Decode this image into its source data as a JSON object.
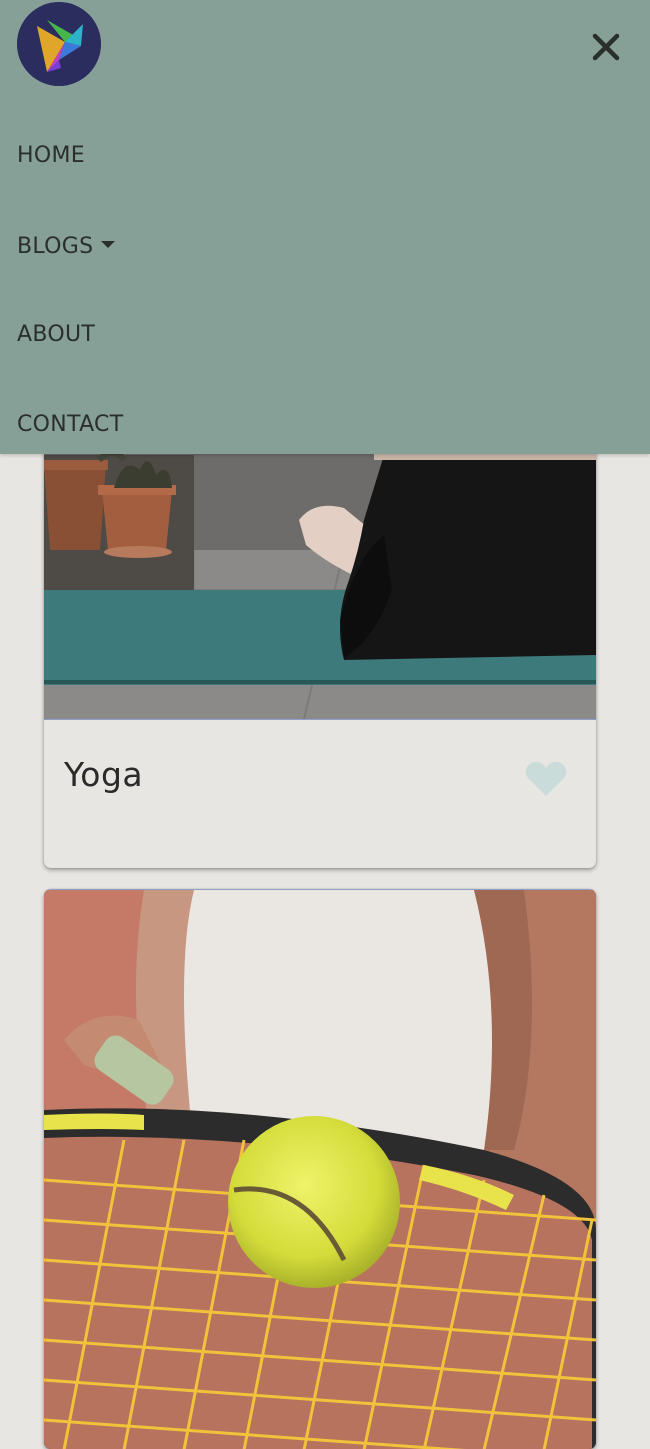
{
  "nav": {
    "logo_icon": "bird-logo-icon",
    "close_icon": "close-icon",
    "items": [
      {
        "label": "HOME"
      },
      {
        "label": "BLOGS",
        "has_dropdown": true
      },
      {
        "label": "ABOUT"
      },
      {
        "label": "CONTACT"
      }
    ]
  },
  "cards": [
    {
      "title": "Yoga",
      "image": "yoga-photo",
      "favorite_icon": "heart-icon"
    },
    {
      "title": "",
      "image": "tennis-photo"
    }
  ],
  "colors": {
    "nav_background": "#87a097",
    "page_background": "#e8e6e2",
    "heart": "#c9dcd9",
    "text": "#2a2f2c"
  }
}
